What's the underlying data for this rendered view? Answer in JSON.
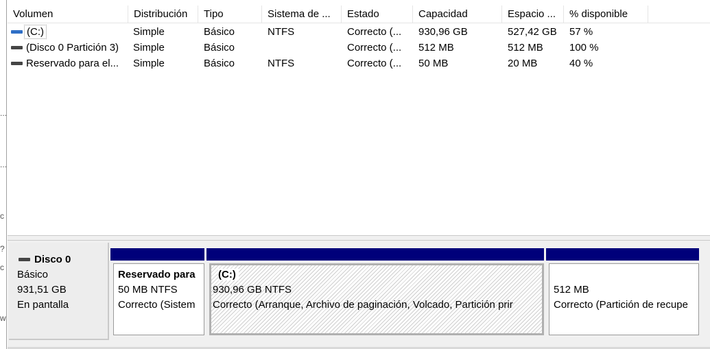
{
  "columns": [
    "Volumen",
    "Distribución",
    "Tipo",
    "Sistema de ...",
    "Estado",
    "Capacidad",
    "Espacio ...",
    "% disponible"
  ],
  "rows": [
    {
      "volume": "(C:)",
      "layout": "Simple",
      "type": "Básico",
      "fs": "NTFS",
      "status": "Correcto (...",
      "capacity": "930,96 GB",
      "free": "527,42 GB",
      "pct": "57 %"
    },
    {
      "volume": "(Disco 0 Partición 3)",
      "layout": "Simple",
      "type": "Básico",
      "fs": "",
      "status": "Correcto (...",
      "capacity": "512 MB",
      "free": "512 MB",
      "pct": "100 %"
    },
    {
      "volume": "Reservado para el...",
      "layout": "Simple",
      "type": "Básico",
      "fs": "NTFS",
      "status": "Correcto (...",
      "capacity": "50 MB",
      "free": "20 MB",
      "pct": "40 %"
    }
  ],
  "disk": {
    "name": "Disco 0",
    "kind": "Básico",
    "size": "931,51 GB",
    "state": "En pantalla"
  },
  "partitions": [
    {
      "name": "Reservado para",
      "size": "50 MB NTFS",
      "status": "Correcto (Sistem"
    },
    {
      "name": "(C:)",
      "size": "930,96 GB NTFS",
      "status": "Correcto (Arranque, Archivo de paginación, Volcado, Partición prir"
    },
    {
      "name": "",
      "size": "512 MB",
      "status": "Correcto (Partición de recupe"
    }
  ],
  "left_strip_glyphs": [
    "...",
    "...",
    "c",
    "?",
    "c",
    "w"
  ],
  "colors": {
    "partition_bar": "#00007a",
    "drive_icon_blue": "#2f6fc6"
  }
}
